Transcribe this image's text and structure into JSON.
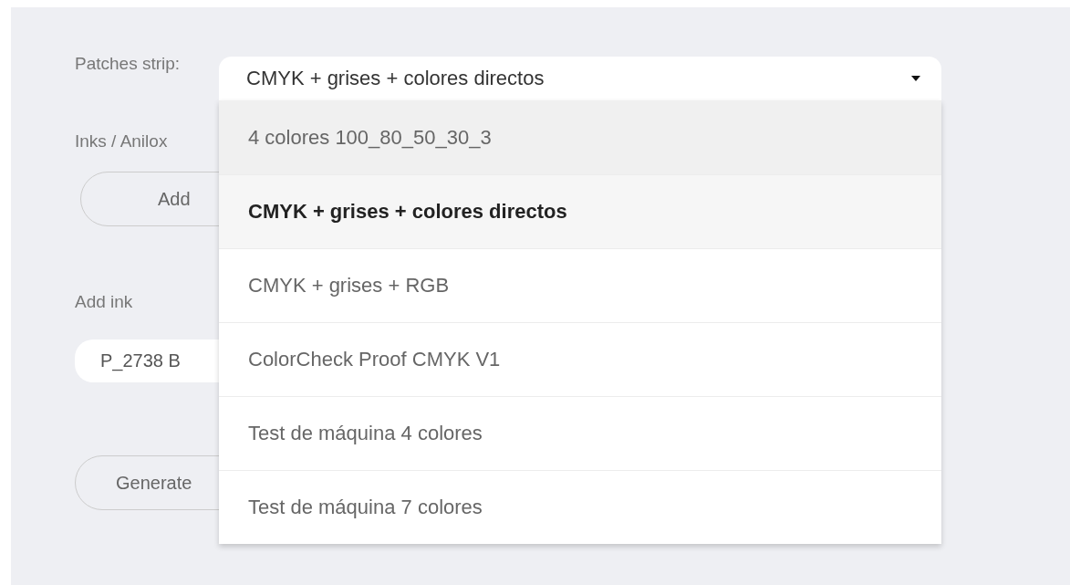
{
  "form": {
    "patches_strip_label": "Patches strip:",
    "inks_label": "Inks / Anilox",
    "add_button": "Add",
    "add_ink_label": "Add ink",
    "ink_field": {
      "value": "P_2738 B"
    },
    "generate_button": "Generate"
  },
  "patches_select": {
    "value": "CMYK + grises + colores directos",
    "expanded": true,
    "options": [
      {
        "label": "4 colores 100_80_50_30_3",
        "selected": false,
        "hovered": true
      },
      {
        "label": "CMYK + grises + colores directos",
        "selected": true,
        "hovered": false
      },
      {
        "label": "CMYK + grises + RGB",
        "selected": false,
        "hovered": false
      },
      {
        "label": "ColorCheck Proof CMYK V1",
        "selected": false,
        "hovered": false
      },
      {
        "label": "Test de máquina 4 colores",
        "selected": false,
        "hovered": false
      },
      {
        "label": "Test de máquina 7 colores",
        "selected": false,
        "hovered": false
      }
    ]
  }
}
